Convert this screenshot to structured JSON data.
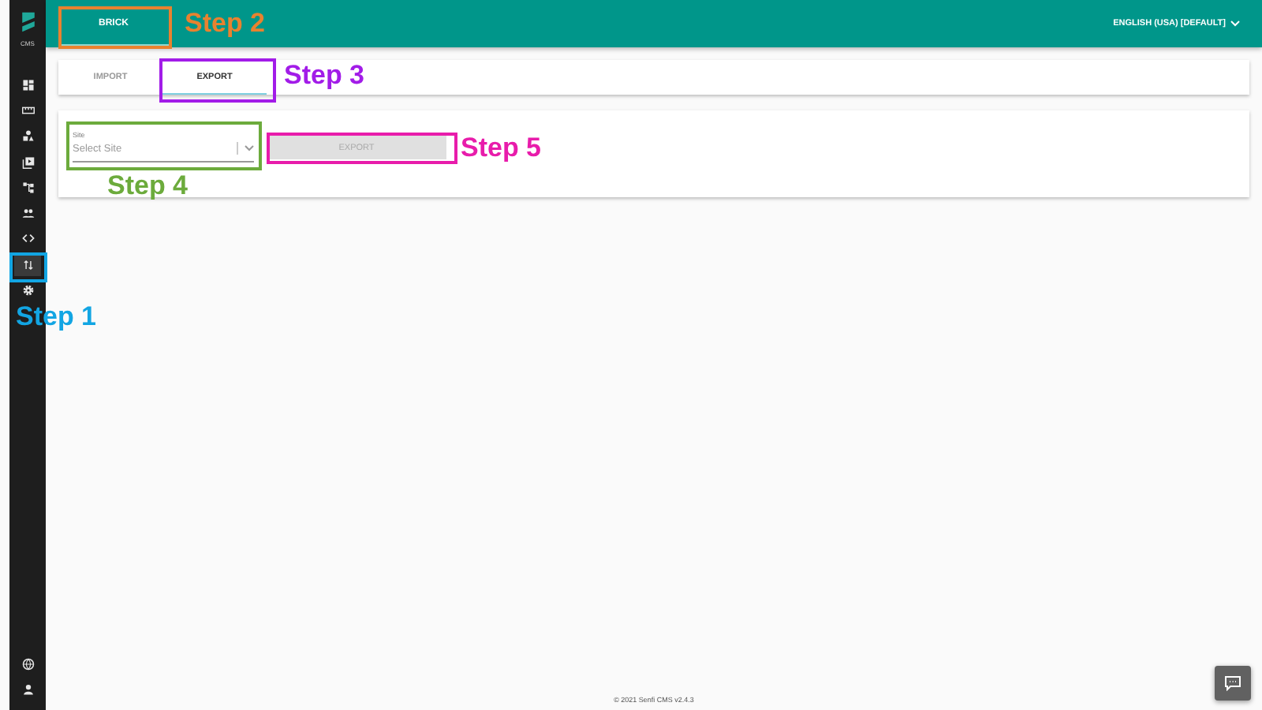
{
  "sidebar": {
    "logo_text": "CMS",
    "items": [
      {
        "kind": "dashboard",
        "selected": false
      },
      {
        "kind": "ruler",
        "selected": false
      },
      {
        "kind": "shapes",
        "selected": false
      },
      {
        "kind": "media",
        "selected": false
      },
      {
        "kind": "sitemap",
        "selected": false
      },
      {
        "kind": "people",
        "selected": false
      },
      {
        "kind": "code",
        "selected": false
      },
      {
        "kind": "transfer",
        "selected": true
      },
      {
        "kind": "settings",
        "selected": false
      }
    ],
    "bottom_items": [
      {
        "kind": "globe",
        "selected": false
      },
      {
        "kind": "user",
        "selected": false
      }
    ]
  },
  "header": {
    "tabs": [
      {
        "label": "BRICK",
        "selected": true
      }
    ],
    "language": "ENGLISH (USA) [DEFAULT]"
  },
  "tabs": [
    {
      "label": "IMPORT",
      "selected": false
    },
    {
      "label": "EXPORT",
      "selected": true
    }
  ],
  "export_form": {
    "field": {
      "label": "Site",
      "placeholder": "Select Site"
    },
    "button": {
      "label": "EXPORT",
      "disabled": true
    }
  },
  "footer": "© 2021 Senfi CMS v2.4.3",
  "annotations": [
    {
      "text": "Step 1",
      "color": "#12a5e3"
    },
    {
      "text": "Step 2",
      "color": "#e8822f"
    },
    {
      "text": "Step 3",
      "color": "#a21ce8"
    },
    {
      "text": "Step 4",
      "color": "#6cab3c"
    },
    {
      "text": "Step 5",
      "color": "#e81cab"
    }
  ]
}
